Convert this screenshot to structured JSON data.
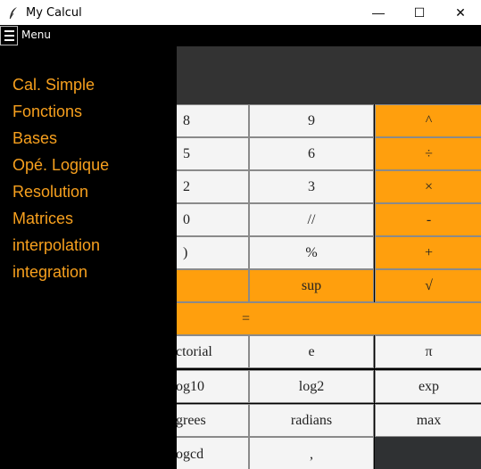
{
  "window": {
    "title": "My Calcul",
    "minimize_glyph": "—",
    "maximize_glyph": "☐",
    "close_glyph": "✕"
  },
  "menubar": {
    "label": "Menu"
  },
  "sidebar": {
    "items": [
      "Cal. Simple",
      "Fonctions",
      "Bases",
      "Opé. Logique",
      "Resolution",
      "Matrices",
      "interpolation",
      "integration"
    ]
  },
  "display": {
    "value": ""
  },
  "keypad": {
    "row1": [
      "8",
      "9",
      "^"
    ],
    "row2": [
      "5",
      "6",
      "÷"
    ],
    "row3": [
      "2",
      "3",
      "×"
    ],
    "row4": [
      "0",
      "//",
      "-"
    ],
    "row5": [
      ")",
      "%",
      "+"
    ],
    "row6": [
      "",
      "sup",
      "√"
    ],
    "row7": [
      "="
    ],
    "row8": [
      "ctorial",
      "e",
      "π"
    ],
    "row9": [
      "og10",
      "log2",
      "exp"
    ],
    "row10": [
      "grees",
      "radians",
      "max"
    ],
    "row11": [
      "ogcd",
      ","
    ]
  },
  "colors": {
    "accent": "#ff9f0d",
    "sidebar_text": "#f7a01e",
    "display_bg": "#333333",
    "key_bg": "#f4f4f4"
  }
}
